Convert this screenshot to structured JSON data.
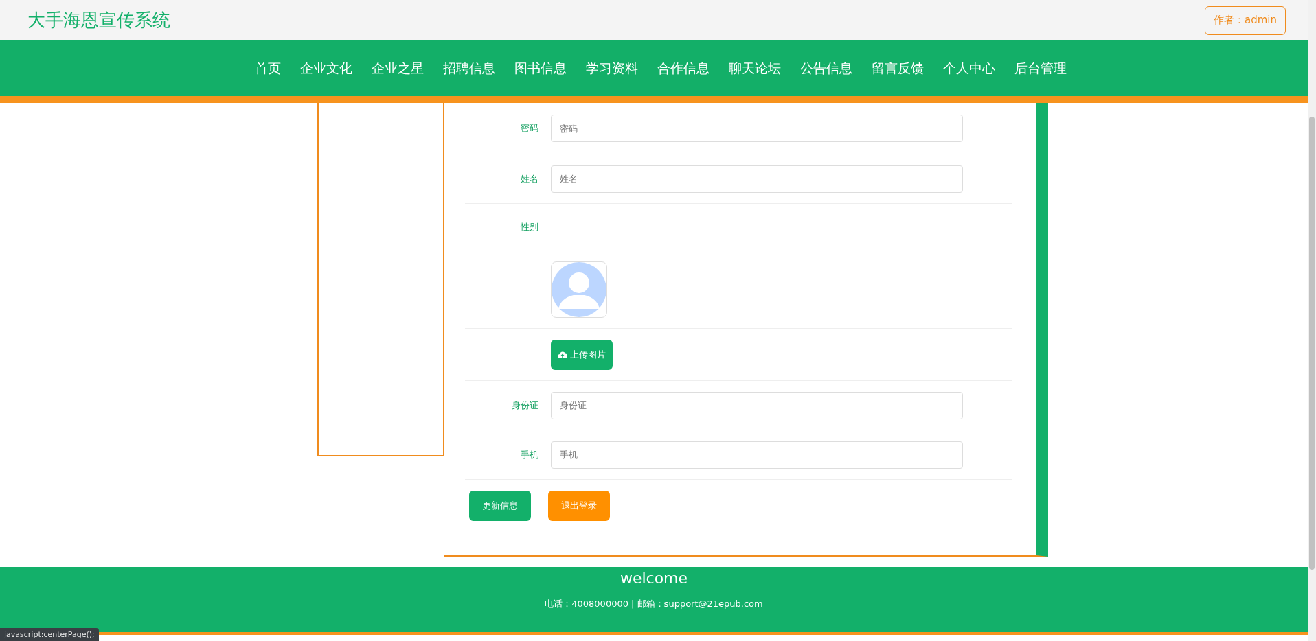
{
  "header": {
    "title": "大手海恩宣传系统",
    "author_button": "作者：admin"
  },
  "nav": {
    "items": [
      "首页",
      "企业文化",
      "企业之星",
      "招聘信息",
      "图书信息",
      "学习资料",
      "合作信息",
      "聊天论坛",
      "公告信息",
      "留言反馈",
      "个人中心",
      "后台管理"
    ]
  },
  "form": {
    "fields": [
      {
        "kind": "input",
        "label": "密码",
        "placeholder": "密码"
      },
      {
        "kind": "input",
        "label": "姓名",
        "placeholder": "姓名"
      },
      {
        "kind": "label",
        "label": "性别"
      },
      {
        "kind": "avatar"
      },
      {
        "kind": "upload",
        "button": "上传图片"
      },
      {
        "kind": "input",
        "label": "身份证",
        "placeholder": "身份证"
      },
      {
        "kind": "input",
        "label": "手机",
        "placeholder": "手机"
      }
    ],
    "buttons": [
      {
        "label": "更新信息",
        "color": "#13b06a"
      },
      {
        "label": "退出登录",
        "color": "#ff9000"
      }
    ]
  },
  "footer": {
    "title": "welcome",
    "contact": "电话：4008000000 | 邮箱：support@21epub.com"
  },
  "status_bar": "javascript:centerPage();"
}
